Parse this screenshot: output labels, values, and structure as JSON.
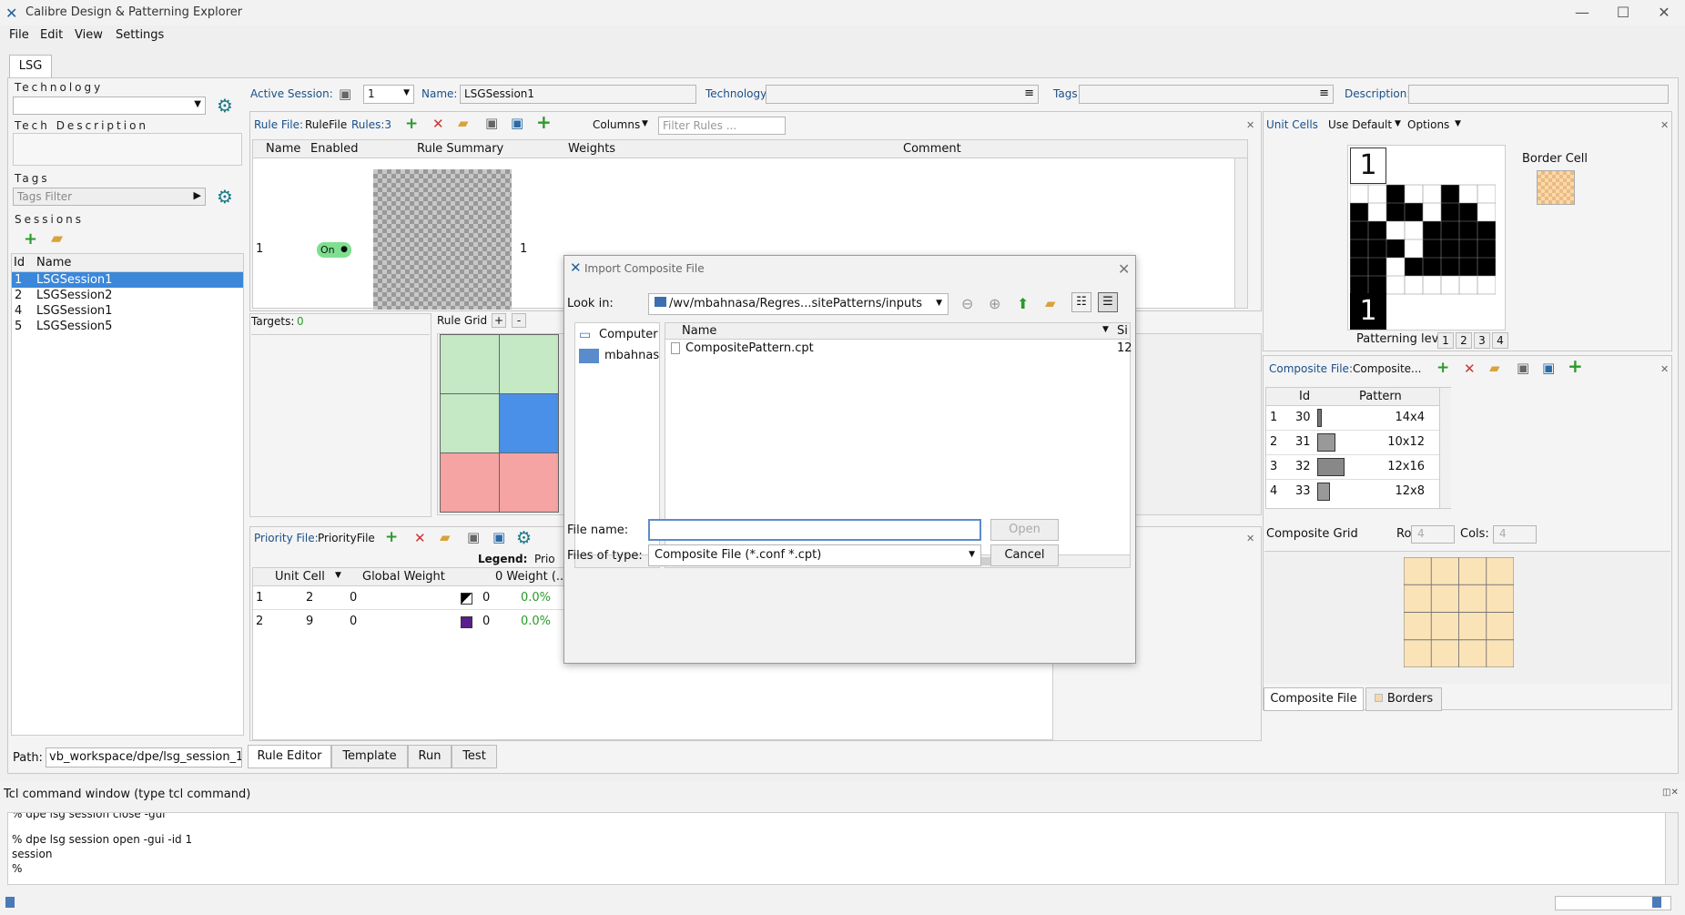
{
  "window": {
    "title": "Calibre Design & Patterning Explorer",
    "minimize": "—",
    "maximize": "☐",
    "close": "✕"
  },
  "menu": [
    "File",
    "Edit",
    "View",
    "Settings"
  ],
  "top_tab": "LSG",
  "left": {
    "technology_label": "Technology",
    "tech_description_label": "Tech Description",
    "tags_label": "Tags",
    "tags_filter_placeholder": "Tags Filter",
    "sessions_label": "Sessions",
    "sessions_cols": [
      "Id",
      "Name"
    ],
    "sessions": [
      {
        "id": "1",
        "name": "LSGSession1"
      },
      {
        "id": "2",
        "name": "LSGSession2"
      },
      {
        "id": "4",
        "name": "LSGSession1"
      },
      {
        "id": "5",
        "name": "LSGSession5"
      }
    ],
    "path_label": "Path:",
    "path_value": "vb_workspace/dpe/lsg_session_1"
  },
  "session_bar": {
    "active_label": "Active Session:",
    "active_value": "1",
    "name_label": "Name:",
    "name_value": "LSGSession1",
    "technology_label": "Technology:",
    "tags_label": "Tags:",
    "description_label": "Description:"
  },
  "rule_file": {
    "label": "Rule File:",
    "file": "RuleFile",
    "rules": "Rules:3",
    "columns_btn": "Columns",
    "filter_placeholder": "Filter Rules ...",
    "cols": [
      "Name",
      "Enabled",
      "Rule Summary",
      "Weights",
      "Comment"
    ],
    "row_id": "1",
    "enabled": "On",
    "weight": "1"
  },
  "targets": {
    "label": "Targets:",
    "count": "0"
  },
  "rule_grid": {
    "label": "Rule Grid",
    "plus": "+",
    "minus": "-"
  },
  "priority": {
    "label": "Priority File:",
    "file": "PriorityFile",
    "legend": "Legend:",
    "legend_value": "Prio",
    "cols": [
      "Unit Cell",
      "Global Weight",
      "0 Weight (..."
    ],
    "rows": [
      {
        "id": "1",
        "unit": "2",
        "global": "0",
        "w": "0",
        "pct": "0.0%",
        "color": "#000000"
      },
      {
        "id": "2",
        "unit": "9",
        "global": "0",
        "w": "0",
        "pct": "0.0%",
        "color": "#5a1f8c"
      }
    ]
  },
  "bottom_tabs": [
    "Rule Editor",
    "Template",
    "Run",
    "Test"
  ],
  "unit_cells": {
    "label": "Unit Cells",
    "use_default": "Use Default",
    "options": "Options",
    "num_top": "1",
    "num_bottom": "1",
    "border_cell": "Border Cell",
    "patterning_level": "Patterning level:",
    "levels": [
      "1",
      "2",
      "3",
      "4"
    ]
  },
  "composite": {
    "label": "Composite File:",
    "file": "Composite...",
    "cols": [
      "Id",
      "Pattern"
    ],
    "rows": [
      {
        "row": "1",
        "id": "30",
        "size": "14x4"
      },
      {
        "row": "2",
        "id": "31",
        "size": "10x12"
      },
      {
        "row": "3",
        "id": "32",
        "size": "12x16"
      },
      {
        "row": "4",
        "id": "33",
        "size": "12x8"
      }
    ],
    "grid_label": "Composite Grid",
    "rows_label": "Rows:",
    "rows_value": "4",
    "cols_label": "Cols:",
    "cols_value": "4",
    "tabs": [
      "Composite File",
      "Borders"
    ]
  },
  "tcl": {
    "title": "Tcl command window (type tcl command)",
    "lines": [
      "% dpe lsg session close -gui",
      "",
      "% dpe lsg session open -gui -id 1",
      "session",
      "%"
    ]
  },
  "dialog": {
    "title": "Import Composite File",
    "look_in_label": "Look in:",
    "look_in_value": "/wv/mbahnasa/Regres...sitePatterns/inputs",
    "places": [
      "Computer",
      "mbahnas"
    ],
    "col_name": "Name",
    "col_size": "Si",
    "files": [
      {
        "name": "CompositePattern.cpt",
        "size": "12"
      }
    ],
    "file_name_label": "File name:",
    "file_name_value": "",
    "files_type_label": "Files of type:",
    "files_type_value": "Composite File (*.conf *.cpt)",
    "open_btn": "Open",
    "cancel_btn": "Cancel"
  }
}
